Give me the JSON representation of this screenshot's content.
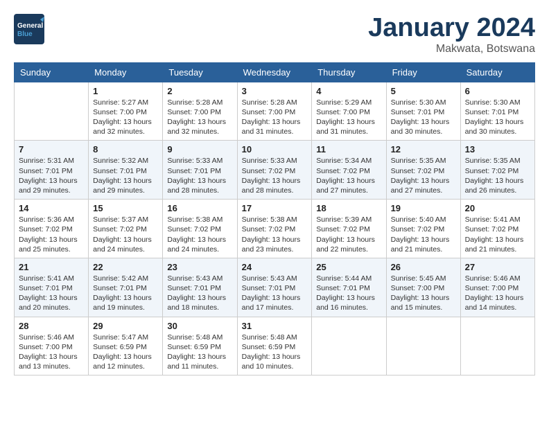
{
  "header": {
    "logo_general": "General",
    "logo_blue": "Blue",
    "month_title": "January 2024",
    "location": "Makwata, Botswana"
  },
  "weekdays": [
    "Sunday",
    "Monday",
    "Tuesday",
    "Wednesday",
    "Thursday",
    "Friday",
    "Saturday"
  ],
  "weeks": [
    [
      {
        "day": "",
        "sunrise": "",
        "sunset": "",
        "daylight": ""
      },
      {
        "day": "1",
        "sunrise": "Sunrise: 5:27 AM",
        "sunset": "Sunset: 7:00 PM",
        "daylight": "Daylight: 13 hours and 32 minutes."
      },
      {
        "day": "2",
        "sunrise": "Sunrise: 5:28 AM",
        "sunset": "Sunset: 7:00 PM",
        "daylight": "Daylight: 13 hours and 32 minutes."
      },
      {
        "day": "3",
        "sunrise": "Sunrise: 5:28 AM",
        "sunset": "Sunset: 7:00 PM",
        "daylight": "Daylight: 13 hours and 31 minutes."
      },
      {
        "day": "4",
        "sunrise": "Sunrise: 5:29 AM",
        "sunset": "Sunset: 7:00 PM",
        "daylight": "Daylight: 13 hours and 31 minutes."
      },
      {
        "day": "5",
        "sunrise": "Sunrise: 5:30 AM",
        "sunset": "Sunset: 7:01 PM",
        "daylight": "Daylight: 13 hours and 30 minutes."
      },
      {
        "day": "6",
        "sunrise": "Sunrise: 5:30 AM",
        "sunset": "Sunset: 7:01 PM",
        "daylight": "Daylight: 13 hours and 30 minutes."
      }
    ],
    [
      {
        "day": "7",
        "sunrise": "Sunrise: 5:31 AM",
        "sunset": "Sunset: 7:01 PM",
        "daylight": "Daylight: 13 hours and 29 minutes."
      },
      {
        "day": "8",
        "sunrise": "Sunrise: 5:32 AM",
        "sunset": "Sunset: 7:01 PM",
        "daylight": "Daylight: 13 hours and 29 minutes."
      },
      {
        "day": "9",
        "sunrise": "Sunrise: 5:33 AM",
        "sunset": "Sunset: 7:01 PM",
        "daylight": "Daylight: 13 hours and 28 minutes."
      },
      {
        "day": "10",
        "sunrise": "Sunrise: 5:33 AM",
        "sunset": "Sunset: 7:02 PM",
        "daylight": "Daylight: 13 hours and 28 minutes."
      },
      {
        "day": "11",
        "sunrise": "Sunrise: 5:34 AM",
        "sunset": "Sunset: 7:02 PM",
        "daylight": "Daylight: 13 hours and 27 minutes."
      },
      {
        "day": "12",
        "sunrise": "Sunrise: 5:35 AM",
        "sunset": "Sunset: 7:02 PM",
        "daylight": "Daylight: 13 hours and 27 minutes."
      },
      {
        "day": "13",
        "sunrise": "Sunrise: 5:35 AM",
        "sunset": "Sunset: 7:02 PM",
        "daylight": "Daylight: 13 hours and 26 minutes."
      }
    ],
    [
      {
        "day": "14",
        "sunrise": "Sunrise: 5:36 AM",
        "sunset": "Sunset: 7:02 PM",
        "daylight": "Daylight: 13 hours and 25 minutes."
      },
      {
        "day": "15",
        "sunrise": "Sunrise: 5:37 AM",
        "sunset": "Sunset: 7:02 PM",
        "daylight": "Daylight: 13 hours and 24 minutes."
      },
      {
        "day": "16",
        "sunrise": "Sunrise: 5:38 AM",
        "sunset": "Sunset: 7:02 PM",
        "daylight": "Daylight: 13 hours and 24 minutes."
      },
      {
        "day": "17",
        "sunrise": "Sunrise: 5:38 AM",
        "sunset": "Sunset: 7:02 PM",
        "daylight": "Daylight: 13 hours and 23 minutes."
      },
      {
        "day": "18",
        "sunrise": "Sunrise: 5:39 AM",
        "sunset": "Sunset: 7:02 PM",
        "daylight": "Daylight: 13 hours and 22 minutes."
      },
      {
        "day": "19",
        "sunrise": "Sunrise: 5:40 AM",
        "sunset": "Sunset: 7:02 PM",
        "daylight": "Daylight: 13 hours and 21 minutes."
      },
      {
        "day": "20",
        "sunrise": "Sunrise: 5:41 AM",
        "sunset": "Sunset: 7:02 PM",
        "daylight": "Daylight: 13 hours and 21 minutes."
      }
    ],
    [
      {
        "day": "21",
        "sunrise": "Sunrise: 5:41 AM",
        "sunset": "Sunset: 7:01 PM",
        "daylight": "Daylight: 13 hours and 20 minutes."
      },
      {
        "day": "22",
        "sunrise": "Sunrise: 5:42 AM",
        "sunset": "Sunset: 7:01 PM",
        "daylight": "Daylight: 13 hours and 19 minutes."
      },
      {
        "day": "23",
        "sunrise": "Sunrise: 5:43 AM",
        "sunset": "Sunset: 7:01 PM",
        "daylight": "Daylight: 13 hours and 18 minutes."
      },
      {
        "day": "24",
        "sunrise": "Sunrise: 5:43 AM",
        "sunset": "Sunset: 7:01 PM",
        "daylight": "Daylight: 13 hours and 17 minutes."
      },
      {
        "day": "25",
        "sunrise": "Sunrise: 5:44 AM",
        "sunset": "Sunset: 7:01 PM",
        "daylight": "Daylight: 13 hours and 16 minutes."
      },
      {
        "day": "26",
        "sunrise": "Sunrise: 5:45 AM",
        "sunset": "Sunset: 7:00 PM",
        "daylight": "Daylight: 13 hours and 15 minutes."
      },
      {
        "day": "27",
        "sunrise": "Sunrise: 5:46 AM",
        "sunset": "Sunset: 7:00 PM",
        "daylight": "Daylight: 13 hours and 14 minutes."
      }
    ],
    [
      {
        "day": "28",
        "sunrise": "Sunrise: 5:46 AM",
        "sunset": "Sunset: 7:00 PM",
        "daylight": "Daylight: 13 hours and 13 minutes."
      },
      {
        "day": "29",
        "sunrise": "Sunrise: 5:47 AM",
        "sunset": "Sunset: 6:59 PM",
        "daylight": "Daylight: 13 hours and 12 minutes."
      },
      {
        "day": "30",
        "sunrise": "Sunrise: 5:48 AM",
        "sunset": "Sunset: 6:59 PM",
        "daylight": "Daylight: 13 hours and 11 minutes."
      },
      {
        "day": "31",
        "sunrise": "Sunrise: 5:48 AM",
        "sunset": "Sunset: 6:59 PM",
        "daylight": "Daylight: 13 hours and 10 minutes."
      },
      {
        "day": "",
        "sunrise": "",
        "sunset": "",
        "daylight": ""
      },
      {
        "day": "",
        "sunrise": "",
        "sunset": "",
        "daylight": ""
      },
      {
        "day": "",
        "sunrise": "",
        "sunset": "",
        "daylight": ""
      }
    ]
  ]
}
